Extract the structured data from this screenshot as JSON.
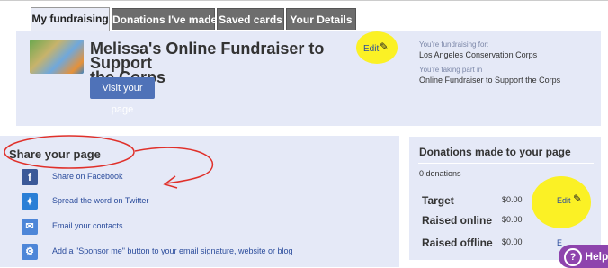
{
  "tabs": [
    {
      "label": "My fundraising"
    },
    {
      "label": "Donations I've made"
    },
    {
      "label": "Saved cards"
    },
    {
      "label": "Your Details"
    }
  ],
  "hero": {
    "title_line1": "Melissa's Online Fundraiser to Support",
    "title_line2": "the Corps",
    "visit_label": "Visit your page",
    "edit_label": "Edit",
    "fundraising_for_label": "You're fundraising for:",
    "fundraising_for_value": "Los Angeles Conservation Corps",
    "taking_part_label": "You're taking part in",
    "taking_part_value": "Online Fundraiser to Support the Corps"
  },
  "share": {
    "title": "Share your page",
    "items": [
      {
        "label": "Share on Facebook",
        "icon": "facebook-icon"
      },
      {
        "label": "Spread the word on Twitter",
        "icon": "twitter-icon"
      },
      {
        "label": "Email your contacts",
        "icon": "email-icon"
      },
      {
        "label": "Add a \"Sponsor me\" button to your email signature, website or blog",
        "icon": "settings-icon"
      }
    ]
  },
  "donations": {
    "title": "Donations made to your page",
    "count": "0 donations",
    "rows": [
      {
        "label": "Target",
        "value": "$0.00",
        "edit": "Edit"
      },
      {
        "label": "Raised online",
        "value": "$0.00"
      },
      {
        "label": "Raised offline",
        "value": "$0.00",
        "edit": "E"
      }
    ]
  },
  "help": {
    "label": "Help"
  },
  "colors": {
    "accent": "#4f72b8",
    "panel": "#e5e9f7",
    "annotation_highlight": "#fff200",
    "annotation_red": "#e0302a"
  }
}
